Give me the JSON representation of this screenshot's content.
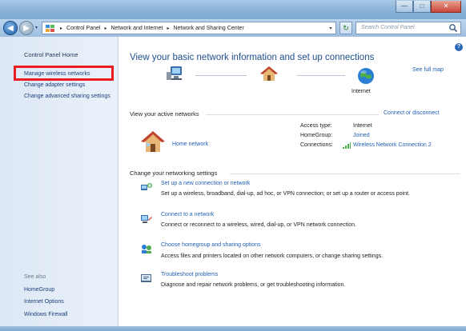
{
  "window": {
    "minimize_glyph": "—",
    "maximize_glyph": "□",
    "close_glyph": "✕"
  },
  "nav": {
    "breadcrumb": [
      "Control Panel",
      "Network and Internet",
      "Network and Sharing Center"
    ],
    "separator": "▸",
    "search_placeholder": "Search Control Panel"
  },
  "sidebar": {
    "home": "Control Panel Home",
    "links": [
      "Manage wireless networks",
      "Change adapter settings",
      "Change advanced sharing settings"
    ],
    "see_also_title": "See also",
    "see_also": [
      "HomeGroup",
      "Internet Options",
      "Windows Firewall"
    ]
  },
  "main": {
    "title": "View your basic network information and set up connections",
    "see_full_map": "See full map",
    "internet_label": "Internet",
    "active_networks_heading": "View your active networks",
    "connect_or_disconnect": "Connect or disconnect",
    "network_name": "Home network",
    "properties": [
      {
        "label": "Access type:",
        "value": "Internet"
      },
      {
        "label": "HomeGroup:",
        "value": "Joined"
      },
      {
        "label": "Connections:",
        "value": "Wireless Network Connection 2"
      }
    ],
    "change_settings_heading": "Change your networking settings",
    "tasks": [
      {
        "link": "Set up a new connection or network",
        "desc": "Set up a wireless, broadband, dial-up, ad hoc, or VPN connection; or set up a router or access point.",
        "icon": "new-connection-icon"
      },
      {
        "link": "Connect to a network",
        "desc": "Connect or reconnect to a wireless, wired, dial-up, or VPN network connection.",
        "icon": "connect-network-icon"
      },
      {
        "link": "Choose homegroup and sharing options",
        "desc": "Access files and printers located on other network computers, or change sharing settings.",
        "icon": "homegroup-icon"
      },
      {
        "link": "Troubleshoot problems",
        "desc": "Diagnose and repair network problems, or get troubleshooting information.",
        "icon": "troubleshoot-icon"
      }
    ]
  },
  "colors": {
    "link": "#1e5fb5",
    "title": "#1f4e8c",
    "highlight": "#ec1c24"
  }
}
